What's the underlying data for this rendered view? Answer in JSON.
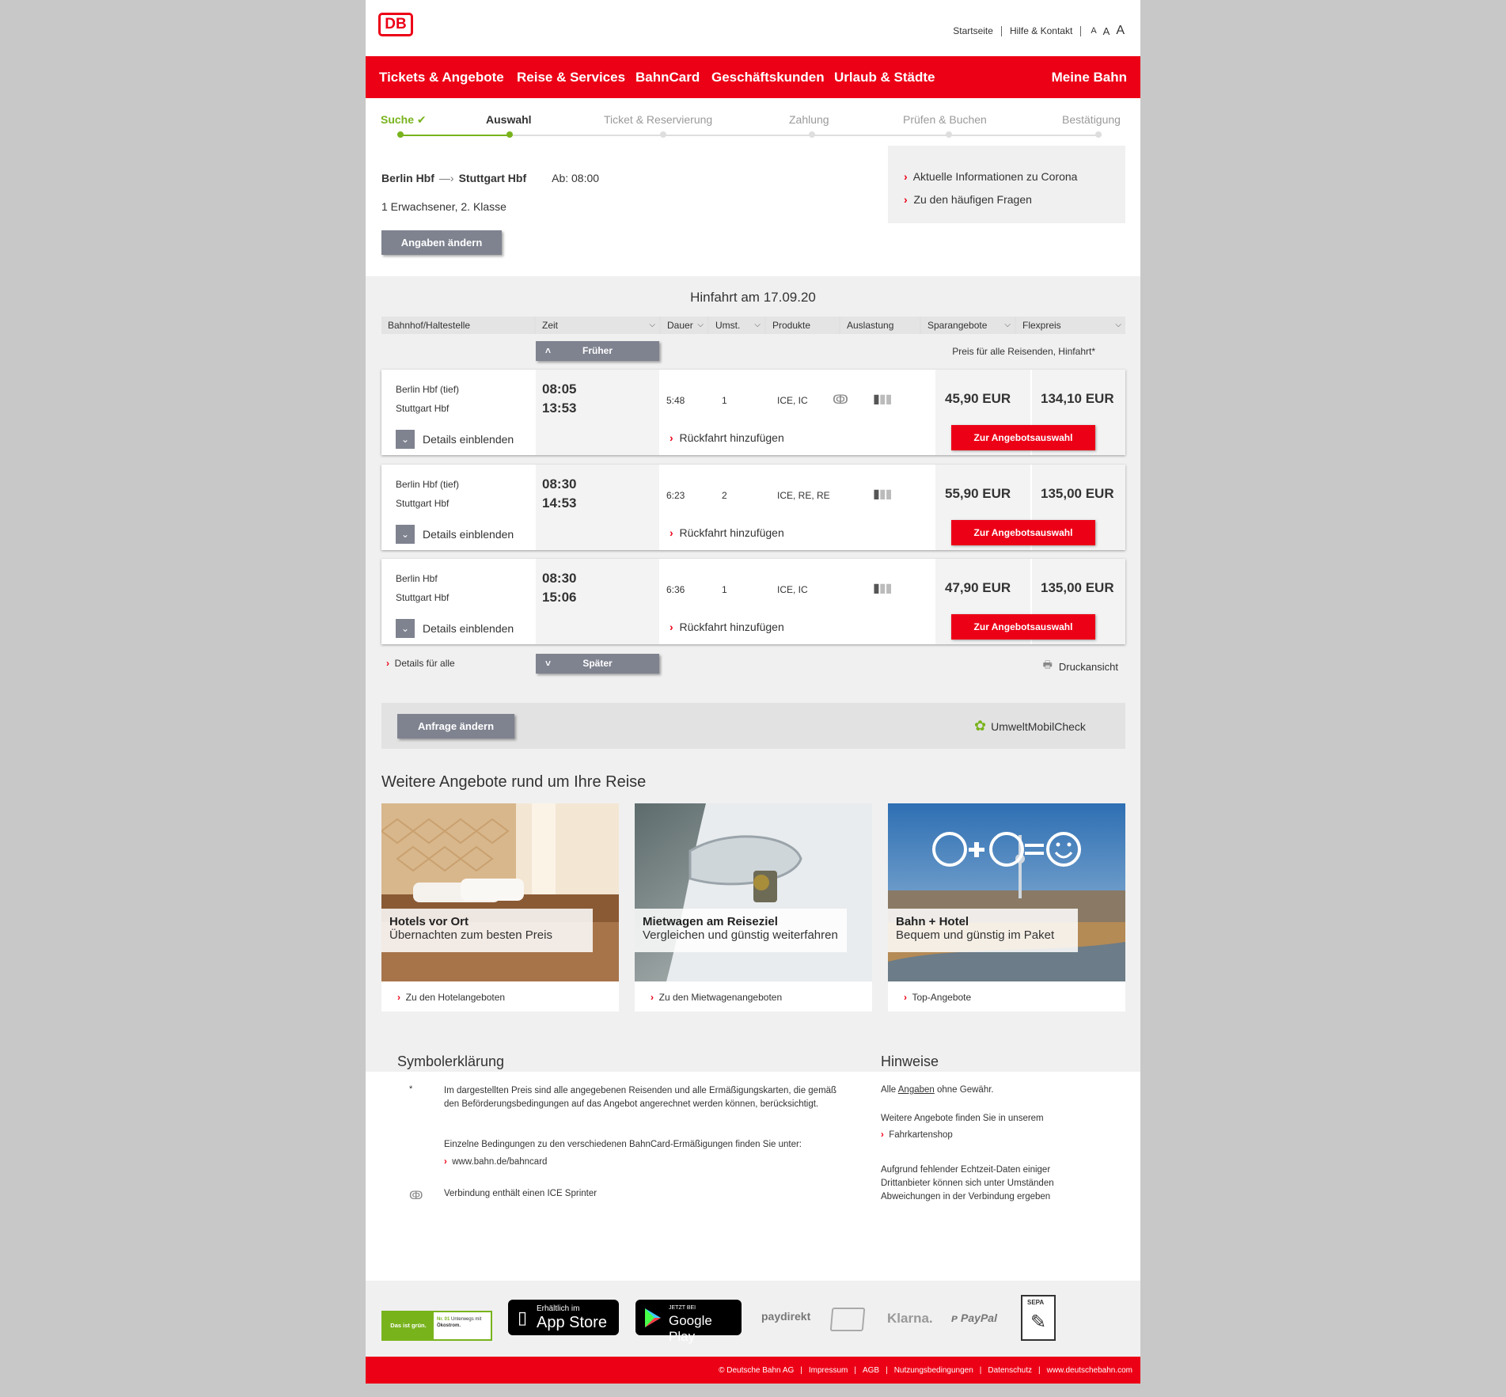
{
  "header": {
    "logo": "DB",
    "links": [
      "Startseite",
      "Hilfe & Kontakt"
    ],
    "font_sizes": [
      "A",
      "A",
      "A"
    ]
  },
  "nav": {
    "items": [
      "Tickets & Angebote",
      "Reise & Services",
      "BahnCard",
      "Geschäftskunden",
      "Urlaub & Städte"
    ],
    "right": "Meine Bahn"
  },
  "steps": [
    "Suche",
    "Auswahl",
    "Ticket & Reservierung",
    "Zahlung",
    "Prüfen & Buchen",
    "Bestätigung"
  ],
  "summary": {
    "from": "Berlin Hbf",
    "to": "Stuttgart Hbf",
    "departure": "Ab: 08:00",
    "travellers": "1 Erwachsener, 2. Klasse",
    "change_button": "Angaben ändern",
    "info_links": [
      "Aktuelle Informationen zu Corona",
      "Zu den häufigen Fragen"
    ]
  },
  "results": {
    "title": "Hinfahrt am 17.09.20",
    "columns": [
      "Bahnhof/Haltestelle",
      "Zeit",
      "Dauer",
      "Umst.",
      "Produkte",
      "Auslastung",
      "Sparangebote",
      "Flexpreis"
    ],
    "earlier": "Früher",
    "later": "Später",
    "price_note": "Preis für alle Reisenden, Hinfahrt*",
    "details_label": "Details einblenden",
    "return_label": "Rückfahrt hinzufügen",
    "offer_button": "Zur Angebotsauswahl",
    "connections": [
      {
        "from": "Berlin Hbf (tief)",
        "to": "Stuttgart Hbf",
        "dep": "08:05",
        "arr": "13:53",
        "duration": "5:48",
        "changes": "1",
        "products": "ICE, IC",
        "sprinter": true,
        "spar": "45,90 EUR",
        "flex": "134,10 EUR"
      },
      {
        "from": "Berlin Hbf (tief)",
        "to": "Stuttgart Hbf",
        "dep": "08:30",
        "arr": "14:53",
        "duration": "6:23",
        "changes": "2",
        "products": "ICE, RE, RE",
        "sprinter": false,
        "spar": "55,90 EUR",
        "flex": "135,00 EUR"
      },
      {
        "from": "Berlin Hbf",
        "to": "Stuttgart Hbf",
        "dep": "08:30",
        "arr": "15:06",
        "duration": "6:36",
        "changes": "1",
        "products": "ICE, IC",
        "sprinter": false,
        "spar": "47,90 EUR",
        "flex": "135,00 EUR"
      }
    ],
    "details_all": "Details für alle",
    "print_view": "Druckansicht",
    "change_request": "Anfrage ändern",
    "umwelt": "UmweltMobilCheck"
  },
  "offers": {
    "title": "Weitere Angebote rund um Ihre Reise",
    "cards": [
      {
        "heading": "Hotels vor Ort",
        "sub": "Übernachten zum besten Preis",
        "link": "Zu den Hotelangeboten"
      },
      {
        "heading": "Mietwagen am Reiseziel",
        "sub": "Vergleichen und günstig weiterfahren",
        "link": "Zu den Mietwagenangeboten"
      },
      {
        "heading": "Bahn + Hotel",
        "sub": "Bequem und günstig im Paket",
        "link": "Top-Angebote"
      }
    ]
  },
  "legend": {
    "title": "Symbolerklärung",
    "asterisk": "*",
    "text1": "Im dargestellten Preis sind alle angegebenen Reisenden und alle Ermäßigungskarten, die gemäß den Beförderungsbedingungen auf das Angebot angerechnet werden können, berücksichtigt.",
    "text2": "Einzelne Bedingungen zu den verschiedenen BahnCard-Ermäßigungen finden Sie unter:",
    "link": "www.bahn.de/bahncard",
    "sprinter_text": "Verbindung enthält einen ICE Sprinter"
  },
  "hints": {
    "title": "Hinweise",
    "line1_pre": "Alle",
    "line1_link": "Angaben",
    "line1_post": "ohne Gewähr.",
    "line2": "Weitere Angebote finden Sie in unserem",
    "shop_link": "Fahrkartenshop",
    "line3": "Aufgrund fehlender Echtzeit-Daten einiger Drittanbieter können sich unter Umständen Abweichungen in der Verbindung ergeben"
  },
  "footer_logos": {
    "green_main": "Das ist grün.",
    "green_nr": "Nr. 01",
    "green_text": "Unterwegs mit",
    "green_bold": "Ökostrom.",
    "appstore_small": "Erhältlich im",
    "appstore_big": "App Store",
    "gplay_small": "JETZT BEI",
    "gplay_big": "Google Play",
    "paydirekt": "paydirekt",
    "klarna": "Klarna.",
    "paypal": "PayPal",
    "sepa": "SEPA"
  },
  "footer_links": [
    "© Deutsche Bahn AG",
    "Impressum",
    "AGB",
    "Nutzungsbedingungen",
    "Datenschutz",
    "www.deutschebahn.com"
  ],
  "colors": {
    "db_red": "#ec0016",
    "green": "#78b31c",
    "button_grey": "#7f8390"
  }
}
